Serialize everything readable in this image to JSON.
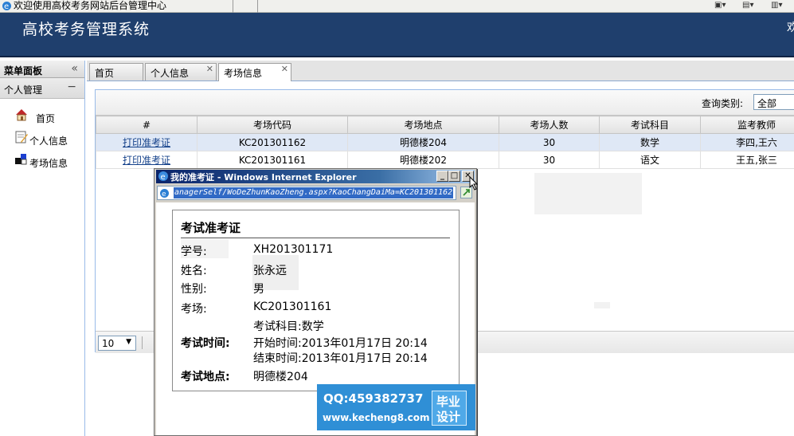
{
  "browser": {
    "title": "欢迎使用高校考务网站后台管理中心"
  },
  "header": {
    "app_title": "高校考务管理系统",
    "welcome_fragment": "欢"
  },
  "sidebar": {
    "title": "菜单面板",
    "collapse_glyph": "«",
    "group": "个人管理",
    "group_toggle": "−",
    "items": [
      {
        "label": "首页",
        "icon": "home-icon"
      },
      {
        "label": "个人信息",
        "icon": "edit-profile-icon"
      },
      {
        "label": "考场信息",
        "icon": "exam-room-icon"
      }
    ]
  },
  "tabs": [
    {
      "label": "首页",
      "closable": false
    },
    {
      "label": "个人信息",
      "closable": true
    },
    {
      "label": "考场信息",
      "closable": true,
      "active": true
    }
  ],
  "toolbar": {
    "query_label": "查询类别:",
    "query_value": "全部"
  },
  "grid": {
    "columns": [
      "#",
      "考场代码",
      "考场地点",
      "考场人数",
      "考试科目",
      "监考教师"
    ],
    "rows": [
      {
        "action": "打印准考证",
        "code": "KC201301162",
        "location": "明德楼204",
        "count": "30",
        "subject": "数学",
        "teachers": "李四,王六"
      },
      {
        "action": "打印准考证",
        "code": "KC201301161",
        "location": "明德楼202",
        "count": "30",
        "subject": "语文",
        "teachers": "王五,张三"
      }
    ]
  },
  "pager": {
    "page_size": "10"
  },
  "popup": {
    "title": "我的准考证 - Windows Internet Explorer",
    "url": "anagerSelf/WoDeZhunKaoZheng.aspx?KaoChangDaiMa=KC201301162",
    "card": {
      "title": "考试准考证",
      "student_id_label": "学号:",
      "student_id": "XH201301171",
      "name_label": "姓名:",
      "name": "张永远",
      "gender_label": "性别:",
      "gender": "男",
      "room_label": "考场:",
      "room": "KC201301161",
      "subject_line": "考试科目:数学",
      "time_label": "考试时间:",
      "start_line": "开始时间:2013年01月17日 20:14",
      "end_line": "结束时间:2013年01月17日 20:14",
      "place_label": "考试地点:",
      "place": "明德楼204"
    }
  },
  "ad": {
    "qq": "QQ:459382737",
    "site": "www.kecheng8.com",
    "badge_line1": "毕业",
    "badge_line2": "设计"
  }
}
